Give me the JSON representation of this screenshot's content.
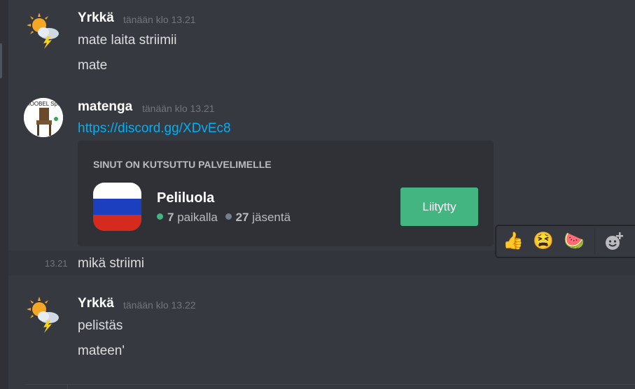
{
  "messages": [
    {
      "username": "Yrkkä",
      "timestamp": "tänään klo 13.21",
      "lines": [
        "mate laita striimii",
        "mate"
      ]
    },
    {
      "username": "matenga",
      "timestamp": "tänään klo 13.21",
      "link": "https://discord.gg/XDvEc8",
      "invite": {
        "header": "SINUT ON KUTSUTTU PALVELIMELLE",
        "server_name": "Peliluola",
        "online_count": "7",
        "online_label": "paikalla",
        "member_count": "27",
        "member_label": "jäsentä",
        "join_label": "Liitytty"
      },
      "avatar_text": "MOOBEL Sponsor"
    },
    {
      "short_timestamp": "13.21",
      "text": "mikä striimi"
    },
    {
      "username": "Yrkkä",
      "timestamp": "tänään klo 13.22",
      "lines": [
        "pelistäs",
        "mateen'"
      ]
    }
  ],
  "reactions": [
    {
      "icon": "thumbs-up-icon",
      "glyph": "👍"
    },
    {
      "icon": "tired-face-icon",
      "glyph": "😫"
    },
    {
      "icon": "watermelon-icon",
      "glyph": "🍉"
    },
    {
      "icon": "add-reaction-icon"
    }
  ],
  "colors": {
    "background": "#36393f",
    "embed": "#2f3136",
    "link": "#00b0f4",
    "join_button": "#43b581",
    "online_dot": "#43b581",
    "member_dot": "#747f8d"
  }
}
